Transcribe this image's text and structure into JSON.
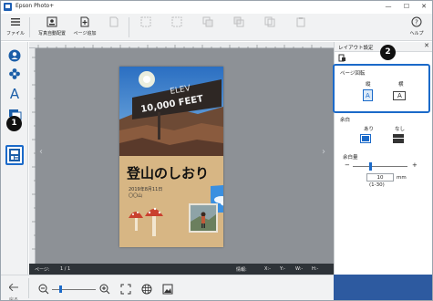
{
  "window": {
    "title": "Epson Photo+"
  },
  "toolbar": {
    "file": "ファイル",
    "auto_layout": "写真自動配置",
    "add_page": "ページ追加",
    "help": "ヘルプ"
  },
  "page": {
    "title": "登山のしおり",
    "date": "2019年8月11日",
    "location": "〇〇山",
    "sign_line1": "ELEV",
    "sign_line2": "10,000 FEET"
  },
  "status": {
    "page_label": "ページ:",
    "page_value": "1 / 1",
    "info_label": "情報:",
    "x": "X:-",
    "y": "Y:-",
    "w": "W:-",
    "h": "H:-"
  },
  "panel": {
    "title": "レイアウト設定",
    "orientation_label": "ページ回転",
    "portrait": "縦",
    "landscape": "横",
    "margin_label": "余白",
    "margin_on": "あり",
    "margin_off": "なし",
    "margin_amount_label": "余白量",
    "margin_value": "10",
    "margin_unit": "mm",
    "margin_range": "(1-30)"
  },
  "bottombar": {
    "back": "戻る"
  },
  "callouts": {
    "one": "1",
    "two": "2"
  },
  "colors": {
    "accent": "#1b6ac9",
    "status_bg": "#2e3338",
    "canvas_bg": "#8d9196"
  }
}
